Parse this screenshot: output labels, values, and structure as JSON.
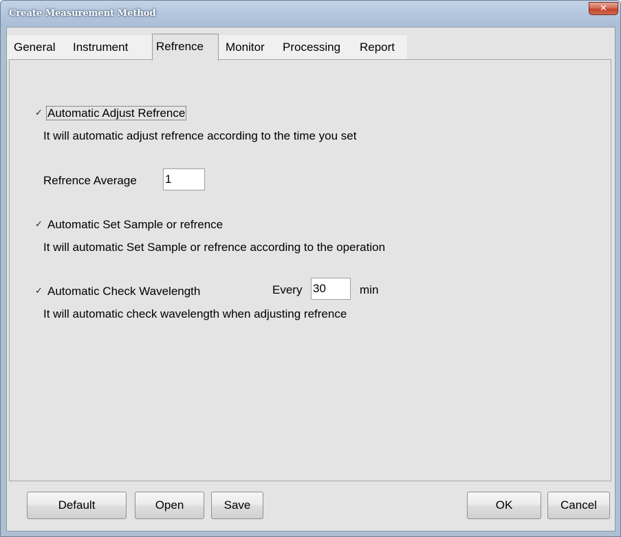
{
  "window": {
    "title": "Create Measurement Method",
    "close_symbol": "✕"
  },
  "tabs": [
    {
      "label": "General",
      "active": false
    },
    {
      "label": "Instrument",
      "active": false
    },
    {
      "label": "Refrence",
      "active": true
    },
    {
      "label": "Monitor",
      "active": false
    },
    {
      "label": "Processing",
      "active": false
    },
    {
      "label": "Report",
      "active": false
    }
  ],
  "refrence_tab": {
    "auto_adjust": {
      "checked": true,
      "check_mark": "✓",
      "label": "Automatic Adjust Refrence",
      "description": "It will automatic adjust refrence according to the time you set"
    },
    "average": {
      "label": "Refrence Average",
      "value": "1"
    },
    "auto_set_sample": {
      "checked": true,
      "check_mark": "✓",
      "label": "Automatic Set Sample or refrence",
      "description": "It will automatic Set Sample or refrence according to the operation"
    },
    "auto_check_wavelength": {
      "checked": true,
      "check_mark": "✓",
      "label": "Automatic Check Wavelength",
      "every_label": "Every",
      "every_value": "30",
      "unit": "min",
      "description": "It will automatic check wavelength when adjusting refrence"
    }
  },
  "buttons": {
    "default": "Default",
    "open": "Open",
    "save": "Save",
    "ok": "OK",
    "cancel": "Cancel"
  },
  "colors": {
    "title_bar": "#b4c7de",
    "close_button": "#c2442c",
    "panel_background": "#e4e4e4"
  }
}
